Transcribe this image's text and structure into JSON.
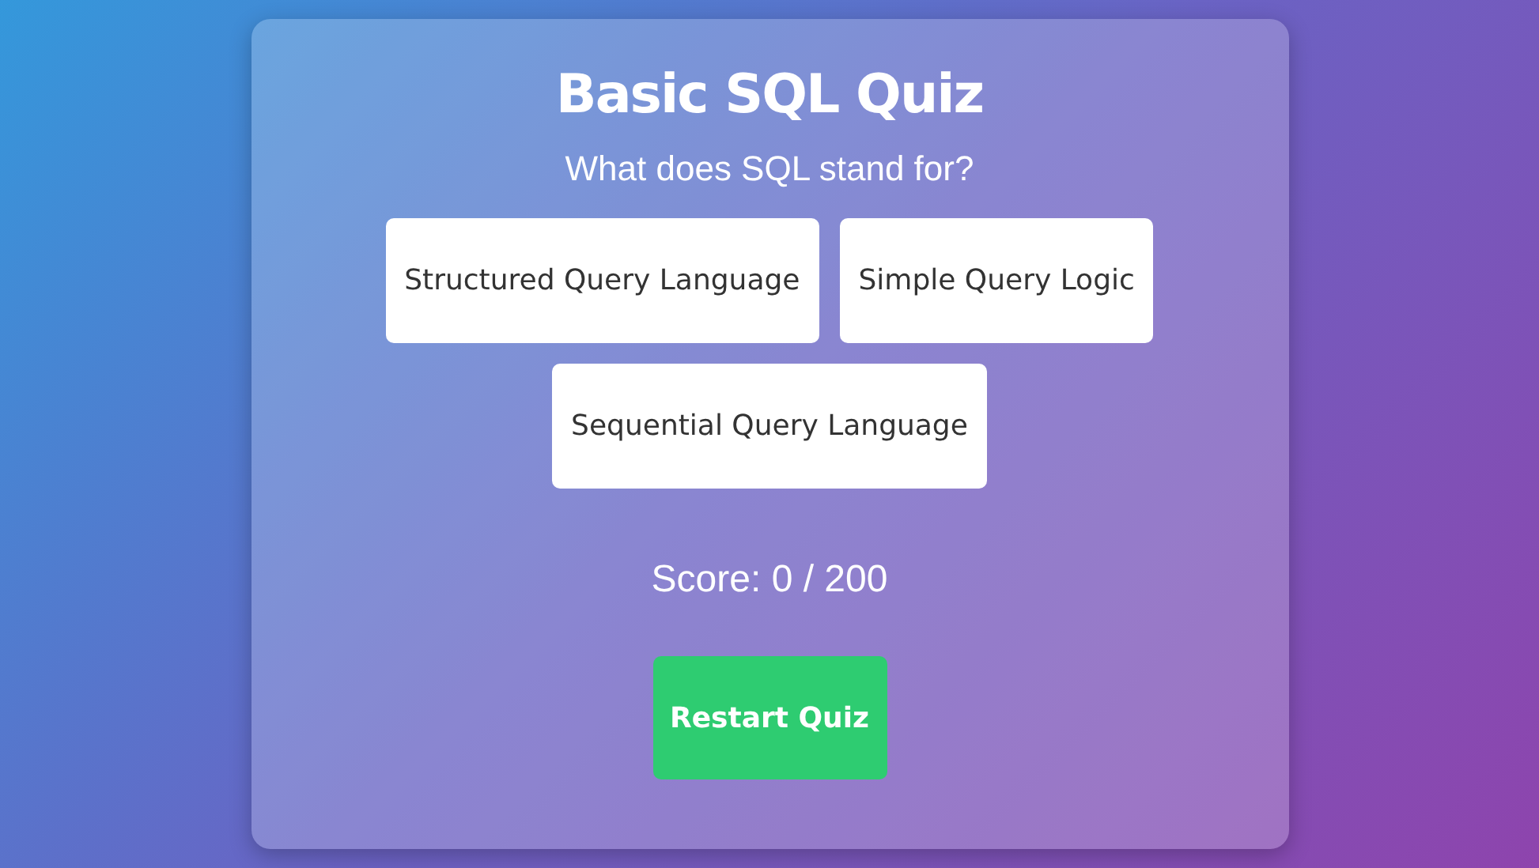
{
  "quiz": {
    "title": "Basic SQL Quiz",
    "question": "What does SQL stand for?",
    "options": [
      {
        "label": "Structured Query Language"
      },
      {
        "label": "Simple Query Logic"
      },
      {
        "label": "Sequential Query Language"
      }
    ],
    "score": "Score: 0 / 200",
    "restart_button": "Restart Quiz"
  }
}
